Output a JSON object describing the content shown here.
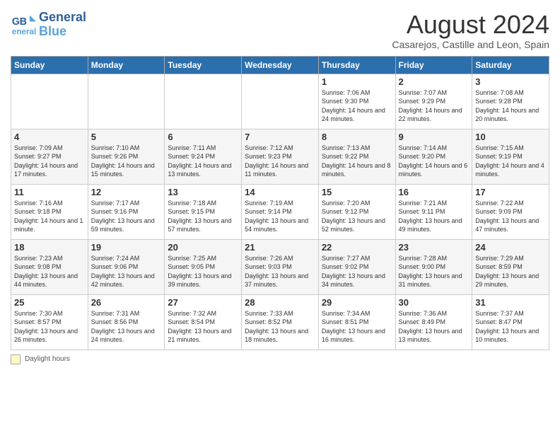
{
  "header": {
    "logo_line1": "General",
    "logo_line2": "Blue",
    "month_year": "August 2024",
    "location": "Casarejos, Castille and Leon, Spain"
  },
  "days_of_week": [
    "Sunday",
    "Monday",
    "Tuesday",
    "Wednesday",
    "Thursday",
    "Friday",
    "Saturday"
  ],
  "weeks": [
    [
      {
        "day": "",
        "info": ""
      },
      {
        "day": "",
        "info": ""
      },
      {
        "day": "",
        "info": ""
      },
      {
        "day": "",
        "info": ""
      },
      {
        "day": "1",
        "info": "Sunrise: 7:06 AM\nSunset: 9:30 PM\nDaylight: 14 hours and 24 minutes."
      },
      {
        "day": "2",
        "info": "Sunrise: 7:07 AM\nSunset: 9:29 PM\nDaylight: 14 hours and 22 minutes."
      },
      {
        "day": "3",
        "info": "Sunrise: 7:08 AM\nSunset: 9:28 PM\nDaylight: 14 hours and 20 minutes."
      }
    ],
    [
      {
        "day": "4",
        "info": "Sunrise: 7:09 AM\nSunset: 9:27 PM\nDaylight: 14 hours and 17 minutes."
      },
      {
        "day": "5",
        "info": "Sunrise: 7:10 AM\nSunset: 9:26 PM\nDaylight: 14 hours and 15 minutes."
      },
      {
        "day": "6",
        "info": "Sunrise: 7:11 AM\nSunset: 9:24 PM\nDaylight: 14 hours and 13 minutes."
      },
      {
        "day": "7",
        "info": "Sunrise: 7:12 AM\nSunset: 9:23 PM\nDaylight: 14 hours and 11 minutes."
      },
      {
        "day": "8",
        "info": "Sunrise: 7:13 AM\nSunset: 9:22 PM\nDaylight: 14 hours and 8 minutes."
      },
      {
        "day": "9",
        "info": "Sunrise: 7:14 AM\nSunset: 9:20 PM\nDaylight: 14 hours and 6 minutes."
      },
      {
        "day": "10",
        "info": "Sunrise: 7:15 AM\nSunset: 9:19 PM\nDaylight: 14 hours and 4 minutes."
      }
    ],
    [
      {
        "day": "11",
        "info": "Sunrise: 7:16 AM\nSunset: 9:18 PM\nDaylight: 14 hours and 1 minute."
      },
      {
        "day": "12",
        "info": "Sunrise: 7:17 AM\nSunset: 9:16 PM\nDaylight: 13 hours and 59 minutes."
      },
      {
        "day": "13",
        "info": "Sunrise: 7:18 AM\nSunset: 9:15 PM\nDaylight: 13 hours and 57 minutes."
      },
      {
        "day": "14",
        "info": "Sunrise: 7:19 AM\nSunset: 9:14 PM\nDaylight: 13 hours and 54 minutes."
      },
      {
        "day": "15",
        "info": "Sunrise: 7:20 AM\nSunset: 9:12 PM\nDaylight: 13 hours and 52 minutes."
      },
      {
        "day": "16",
        "info": "Sunrise: 7:21 AM\nSunset: 9:11 PM\nDaylight: 13 hours and 49 minutes."
      },
      {
        "day": "17",
        "info": "Sunrise: 7:22 AM\nSunset: 9:09 PM\nDaylight: 13 hours and 47 minutes."
      }
    ],
    [
      {
        "day": "18",
        "info": "Sunrise: 7:23 AM\nSunset: 9:08 PM\nDaylight: 13 hours and 44 minutes."
      },
      {
        "day": "19",
        "info": "Sunrise: 7:24 AM\nSunset: 9:06 PM\nDaylight: 13 hours and 42 minutes."
      },
      {
        "day": "20",
        "info": "Sunrise: 7:25 AM\nSunset: 9:05 PM\nDaylight: 13 hours and 39 minutes."
      },
      {
        "day": "21",
        "info": "Sunrise: 7:26 AM\nSunset: 9:03 PM\nDaylight: 13 hours and 37 minutes."
      },
      {
        "day": "22",
        "info": "Sunrise: 7:27 AM\nSunset: 9:02 PM\nDaylight: 13 hours and 34 minutes."
      },
      {
        "day": "23",
        "info": "Sunrise: 7:28 AM\nSunset: 9:00 PM\nDaylight: 13 hours and 31 minutes."
      },
      {
        "day": "24",
        "info": "Sunrise: 7:29 AM\nSunset: 8:59 PM\nDaylight: 13 hours and 29 minutes."
      }
    ],
    [
      {
        "day": "25",
        "info": "Sunrise: 7:30 AM\nSunset: 8:57 PM\nDaylight: 13 hours and 26 minutes."
      },
      {
        "day": "26",
        "info": "Sunrise: 7:31 AM\nSunset: 8:56 PM\nDaylight: 13 hours and 24 minutes."
      },
      {
        "day": "27",
        "info": "Sunrise: 7:32 AM\nSunset: 8:54 PM\nDaylight: 13 hours and 21 minutes."
      },
      {
        "day": "28",
        "info": "Sunrise: 7:33 AM\nSunset: 8:52 PM\nDaylight: 13 hours and 18 minutes."
      },
      {
        "day": "29",
        "info": "Sunrise: 7:34 AM\nSunset: 8:51 PM\nDaylight: 13 hours and 16 minutes."
      },
      {
        "day": "30",
        "info": "Sunrise: 7:36 AM\nSunset: 8:49 PM\nDaylight: 13 hours and 13 minutes."
      },
      {
        "day": "31",
        "info": "Sunrise: 7:37 AM\nSunset: 8:47 PM\nDaylight: 13 hours and 10 minutes."
      }
    ]
  ],
  "footer": {
    "legend_label": "Daylight hours"
  }
}
